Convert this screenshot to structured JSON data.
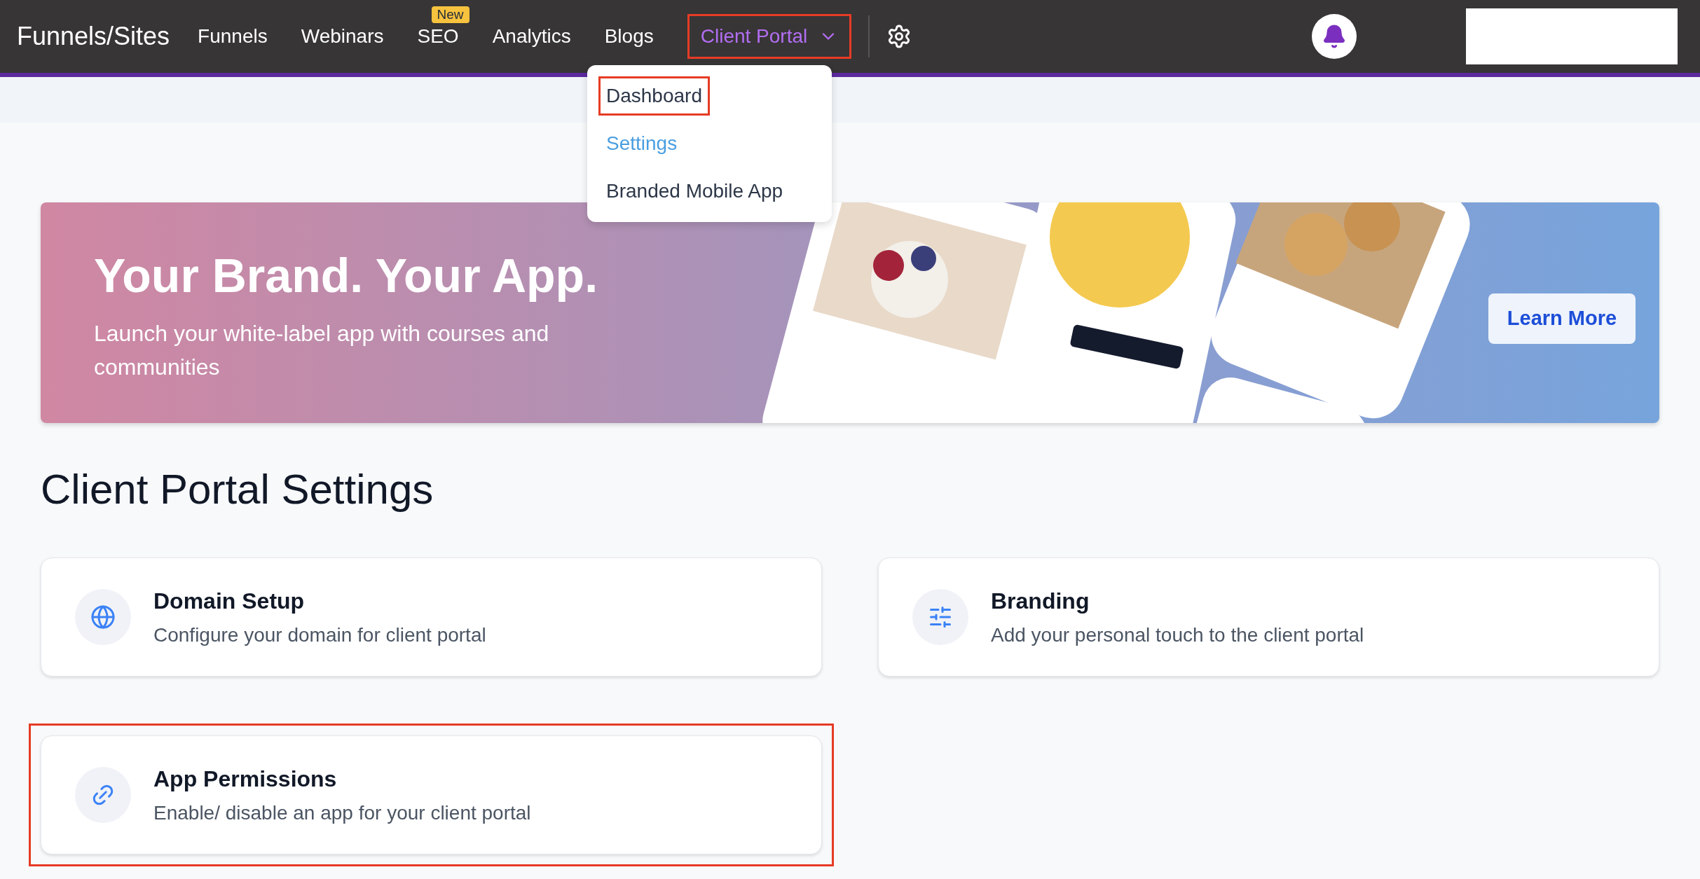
{
  "nav": {
    "logo": "Funnels/Sites",
    "items": [
      {
        "label": "Funnels",
        "selected": false,
        "highlighted": false
      },
      {
        "label": "Webinars",
        "selected": false,
        "highlighted": false
      },
      {
        "label": "SEO",
        "selected": false,
        "highlighted": false,
        "badge": "New"
      },
      {
        "label": "Analytics",
        "selected": false,
        "highlighted": false
      },
      {
        "label": "Blogs",
        "selected": false,
        "highlighted": false
      },
      {
        "label": "Client Portal",
        "selected": true,
        "highlighted": true,
        "dropdown": true
      }
    ]
  },
  "dropdown": {
    "items": [
      {
        "label": "Dashboard",
        "selected": false,
        "highlighted": true
      },
      {
        "label": "Settings",
        "selected": true,
        "highlighted": false
      },
      {
        "label": "Branded Mobile App",
        "selected": false,
        "highlighted": false
      }
    ]
  },
  "banner": {
    "title": "Your Brand. Your App.",
    "subtitle": "Launch your white-label app with courses and communities",
    "button": "Learn More"
  },
  "heading": "Client Portal Settings",
  "cards": [
    {
      "kind": "globe",
      "title": "Domain Setup",
      "description": "Configure your domain for client portal",
      "highlighted": false
    },
    {
      "kind": "sliders",
      "title": "Branding",
      "description": "Add your personal touch to the client portal",
      "highlighted": false
    },
    {
      "kind": "link",
      "title": "App Permissions",
      "description": "Enable/ disable an app for your client portal",
      "highlighted": true
    }
  ]
}
